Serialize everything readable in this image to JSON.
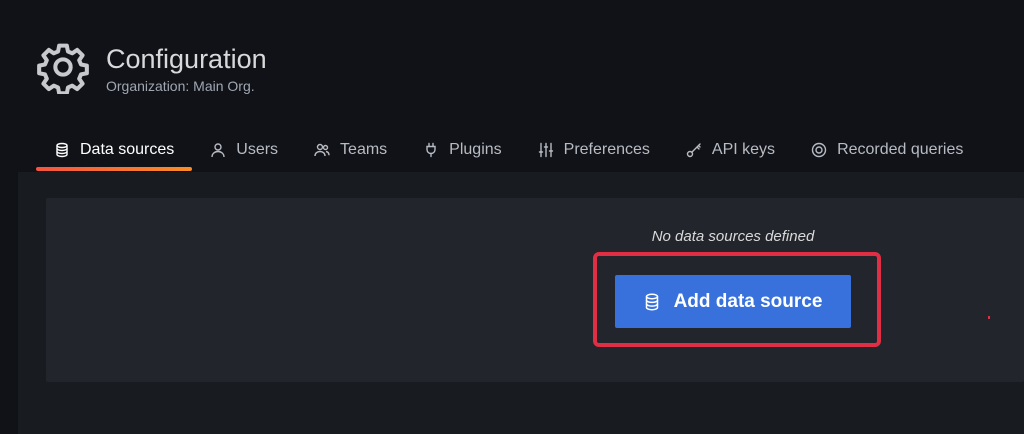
{
  "header": {
    "title": "Configuration",
    "subtitle": "Organization: Main Org.",
    "icon": "gear-icon"
  },
  "tabs": [
    {
      "label": "Data sources",
      "icon": "database-icon",
      "active": true
    },
    {
      "label": "Users",
      "icon": "user-icon",
      "active": false
    },
    {
      "label": "Teams",
      "icon": "users-icon",
      "active": false
    },
    {
      "label": "Plugins",
      "icon": "plug-icon",
      "active": false
    },
    {
      "label": "Preferences",
      "icon": "sliders-icon",
      "active": false
    },
    {
      "label": "API keys",
      "icon": "key-icon",
      "active": false
    },
    {
      "label": "Recorded queries",
      "icon": "record-icon",
      "active": false
    }
  ],
  "empty_state": {
    "message": "No data sources defined",
    "button_label": "Add data source",
    "button_icon": "database-icon"
  },
  "colors": {
    "background": "#111217",
    "panel": "#22252b",
    "primary_button": "#3871dc",
    "tab_underline_start": "#f6533f",
    "tab_underline_end": "#fb8c26",
    "highlight_border": "#e02f44"
  }
}
